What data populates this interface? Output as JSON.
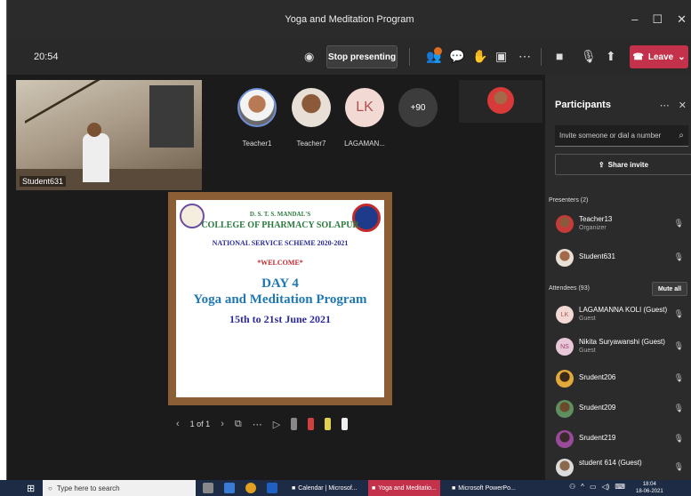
{
  "window": {
    "title": "Yoga and Meditation Program",
    "controls": [
      "–",
      "☐",
      "✕"
    ]
  },
  "toolbar": {
    "clock": "20:54",
    "stop_presenting": "Stop presenting",
    "leave": "Leave",
    "icons": [
      "participants-icon",
      "chat-icon",
      "raise-hand-icon",
      "rooms-icon",
      "more-icon",
      "camera-off-icon",
      "mic-off-icon",
      "share-icon"
    ]
  },
  "stage": {
    "camera": {
      "name": "Student631"
    },
    "tiles": [
      {
        "label": "Teacher1"
      },
      {
        "label": "Teacher7"
      },
      {
        "label": "LAGAMAN...",
        "initials": "LK"
      },
      {
        "label": "",
        "count": "+90"
      }
    ]
  },
  "slide": {
    "line1": "D. S. T. S. MANDAL'S",
    "line2": "COLLEGE OF PHARMACY SOLAPUR",
    "line3": "NATIONAL SERVICE SCHEME 2020-2021",
    "line4": "*WELCOME*",
    "line5": "DAY 4",
    "line6": "Yoga and Meditation Program",
    "line7": "15th to 21st June 2021"
  },
  "slide_controls": {
    "page": "1 of 1"
  },
  "participants": {
    "title": "Participants",
    "invite_placeholder": "Invite someone or dial a number",
    "share_invite": "Share invite",
    "presenters_heading": "Presenters (2)",
    "attendees_heading": "Attendees (93)",
    "mute_all": "Mute all",
    "presenters": [
      {
        "name": "Teacher13",
        "role": "Organizer"
      },
      {
        "name": "Student631",
        "role": ""
      }
    ],
    "attendees": [
      {
        "name": "LAGAMANNA KOLI (Guest)",
        "role": "Guest",
        "initials": "LK"
      },
      {
        "name": "Nikita Suryawanshi (Guest)",
        "role": "Guest",
        "initials": "NS"
      },
      {
        "name": "Srudent206",
        "role": ""
      },
      {
        "name": "Srudent209",
        "role": ""
      },
      {
        "name": "Srudent219",
        "role": ""
      },
      {
        "name": "student 614 (Guest)",
        "role": ""
      }
    ]
  },
  "taskbar": {
    "search_placeholder": "Type here to search",
    "apps": [
      {
        "label": "Calendar | Microsof..."
      },
      {
        "label": "Yoga and Meditatio..."
      },
      {
        "label": "Microsoft PowerPo..."
      }
    ],
    "time": "18:04",
    "date": "18-06-2021"
  }
}
